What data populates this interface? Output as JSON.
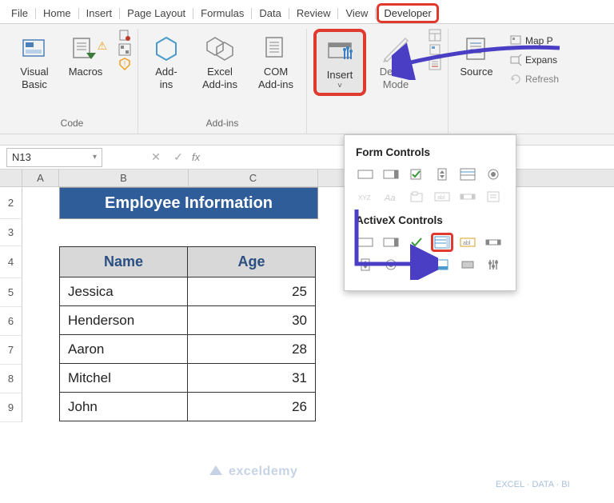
{
  "tabs": [
    "File",
    "Home",
    "Insert",
    "Page Layout",
    "Formulas",
    "Data",
    "Review",
    "View",
    "Developer"
  ],
  "ribbon": {
    "code": {
      "visual_basic": "Visual\nBasic",
      "macros": "Macros",
      "label": "Code"
    },
    "addins": {
      "addins": "Add-\nins",
      "excel_addins": "Excel\nAdd-ins",
      "com_addins": "COM\nAdd-ins",
      "label": "Add-ins"
    },
    "controls": {
      "insert": "Insert",
      "design_mode": "Design\nMode"
    },
    "xml": {
      "source": "Source",
      "map": "Map P",
      "expans": "Expans",
      "refresh": "Refresh"
    }
  },
  "namebox": "N13",
  "fx": "fx",
  "columns": [
    "A",
    "B",
    "C"
  ],
  "rows": [
    "2",
    "3",
    "4",
    "5",
    "6",
    "7",
    "8",
    "9"
  ],
  "title": "Employee Information",
  "table": {
    "headers": [
      "Name",
      "Age"
    ],
    "data": [
      [
        "Jessica",
        "25"
      ],
      [
        "Henderson",
        "30"
      ],
      [
        "Aaron",
        "28"
      ],
      [
        "Mitchel",
        "31"
      ],
      [
        "John",
        "26"
      ]
    ]
  },
  "popup": {
    "form_header": "Form Controls",
    "activex_header": "ActiveX Controls",
    "form_icons": [
      "button",
      "combo",
      "check",
      "spin",
      "list",
      "radio",
      "xyz",
      "aa",
      "group",
      "abl",
      "scroll",
      "more"
    ],
    "activex_icons": [
      "button",
      "combo",
      "check",
      "list",
      "abl",
      "scroll",
      "spin",
      "radio",
      "A",
      "img",
      "toggle",
      "tools"
    ]
  },
  "watermark": "exceldemy",
  "watermark2": "EXCEL · DATA · BI"
}
